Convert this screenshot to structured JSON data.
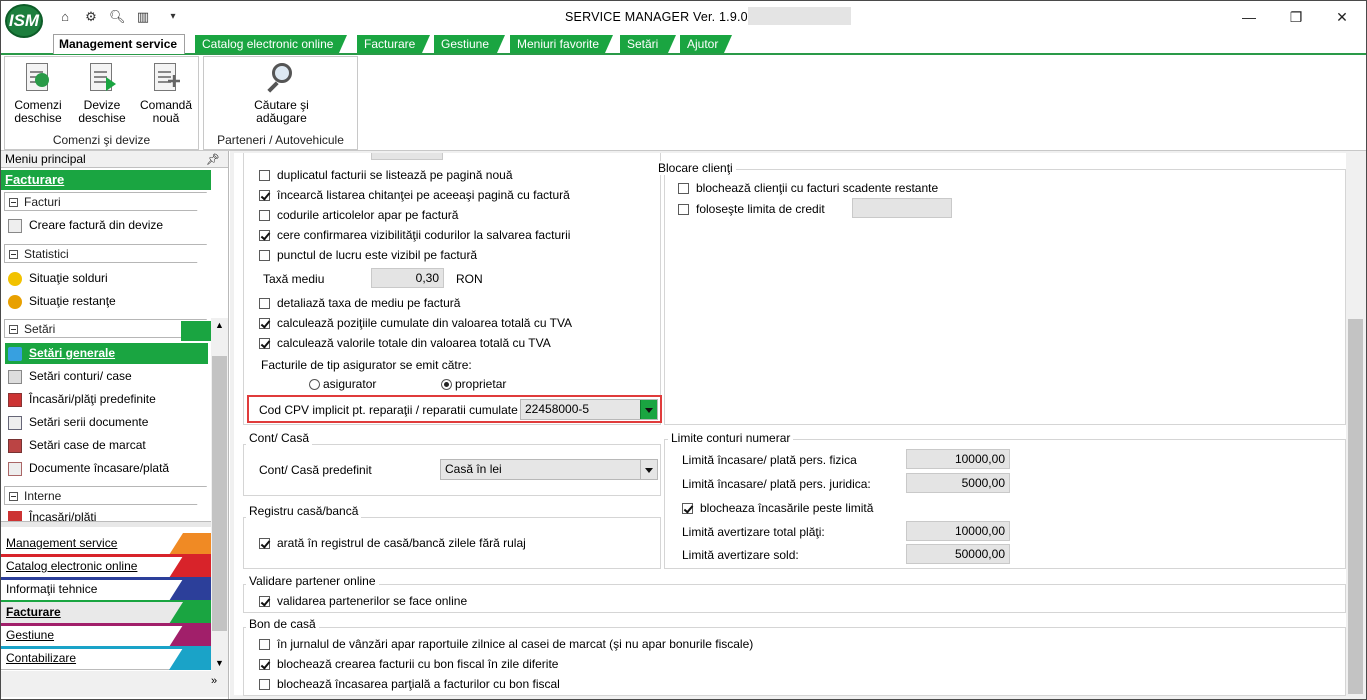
{
  "app": {
    "title": "SERVICE MANAGER Ver. 1.9.0",
    "logo_text": "ISM",
    "colors": {
      "accent": "#1aa541",
      "highlight": "#e03b3b"
    }
  },
  "quick_access": [
    "home-icon",
    "tools-icon",
    "search-doc-icon",
    "barcode-icon",
    "dropdown-icon"
  ],
  "window_controls": {
    "minimize": "—",
    "maximize": "❐",
    "close": "✕"
  },
  "ribbon_tabs": {
    "active": "Management service",
    "tabs": [
      "Catalog electronic online",
      "Facturare",
      "Gestiune",
      "Meniuri favorite",
      "Setări",
      "Ajutor"
    ]
  },
  "ribbon": {
    "group1": {
      "label": "Comenzi şi devize",
      "buttons": [
        "Comenzi deschise",
        "Devize deschise",
        "Comandă nouă"
      ]
    },
    "group2": {
      "label": "Parteneri / Autovehicule",
      "buttons": [
        "Căutare şi adăugare"
      ]
    }
  },
  "sidebar": {
    "header": "Meniu principal",
    "module": "Facturare",
    "sections": [
      {
        "title": "Facturi",
        "items": [
          "Creare factură din devize"
        ]
      },
      {
        "title": "Statistici",
        "items": [
          "Situaţie solduri",
          "Situaţie restanţe"
        ]
      },
      {
        "title": "Setări",
        "items": [
          "Setări generale",
          "Setări conturi/ case",
          "Încasări/plăţi predefinite",
          "Setări serii documente",
          "Setări case de marcat",
          "Documente încasare/plată"
        ]
      },
      {
        "title": "Interne",
        "items": [
          "Încasări/plăţi"
        ]
      }
    ],
    "modules": [
      "Management service",
      "Catalog electronic online",
      "Informaţii tehnice",
      "Facturare",
      "Gestiune",
      "Contabilizare"
    ]
  },
  "facturare": {
    "checks": [
      {
        "label": "duplicatul facturii se listează pe pagină nouă",
        "checked": false
      },
      {
        "label": "încearcă listarea chitanţei pe aceeaşi pagină cu factură",
        "checked": true
      },
      {
        "label": "codurile articolelor apar pe factură",
        "checked": false
      },
      {
        "label": "cere confirmarea vizibilităţii codurilor la salvarea facturii",
        "checked": true
      },
      {
        "label": "punctul de lucru este vizibil pe factură",
        "checked": false
      }
    ],
    "taxa_label": "Taxă mediu",
    "taxa_value": "0,30",
    "taxa_unit": "RON",
    "checks2": [
      {
        "label": "detaliază taxa de mediu pe factură",
        "checked": false
      },
      {
        "label": "calculează poziţiile cumulate din valoarea totală cu TVA",
        "checked": true
      },
      {
        "label": "calculează valorile totale din valoarea  totală cu TVA",
        "checked": true
      }
    ],
    "asigurator_label": "Facturile de tip asigurator se emit către:",
    "radio_asigurator": "asigurator",
    "radio_proprietar": "proprietar",
    "selected": "proprietar",
    "cpv_label": "Cod CPV implicit pt. reparaţii / reparatii cumulate",
    "cpv_value": "22458000-5"
  },
  "blocare": {
    "title": "Blocare clienţi",
    "checks": [
      {
        "label": "blochează clienţii cu facturi scadente restante",
        "checked": false
      },
      {
        "label": "foloseşte limita de credit",
        "checked": false
      }
    ]
  },
  "cont_casa": {
    "title": "Cont/ Casă",
    "label": "Cont/ Casă predefinit",
    "value": "Casă în lei"
  },
  "registru": {
    "title": "Registru casă/bancă",
    "check": "arată în registrul de casă/bancă zilele fără rulaj",
    "checked": true
  },
  "limite": {
    "title": "Limite conturi numerar",
    "fizica_label": "Limită încasare/ plată pers. fizica",
    "fizica_value": "10000,00",
    "juridica_label": "Limită încasare/ plată pers. juridica:",
    "juridica_value": "5000,00",
    "check": "blocheaza încasările peste limită",
    "checked": true,
    "total_label": "Limită avertizare total plăţi:",
    "total_value": "10000,00",
    "sold_label": "Limită avertizare sold:",
    "sold_value": "50000,00"
  },
  "validare": {
    "title": "Validare partener online",
    "check": "validarea partenerilor se face online",
    "checked": true
  },
  "bon": {
    "title": "Bon de casă",
    "checks": [
      {
        "label": "în jurnalul de vânzări apar raportuile zilnice al casei de marcat (şi nu apar bonurile fiscale)",
        "checked": false
      },
      {
        "label": "blochează crearea facturii cu bon fiscal în zile diferite",
        "checked": true
      },
      {
        "label": "blochează încasarea parţială a facturilor cu bon fiscal",
        "checked": false
      }
    ]
  }
}
